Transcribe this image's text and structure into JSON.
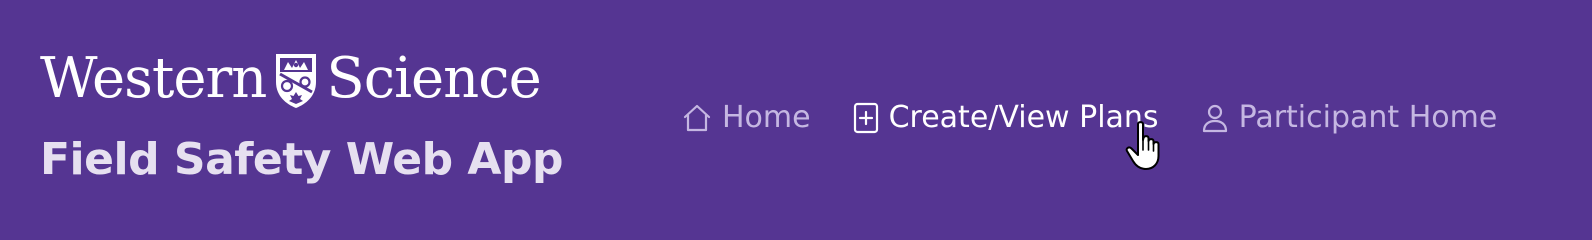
{
  "brand": {
    "word_left": "Western",
    "word_right": "Science",
    "crest_icon": "western-university-crest-icon",
    "app_title": "Field Safety Web App"
  },
  "nav": {
    "items": [
      {
        "label": "Home",
        "icon": "house-icon",
        "active": false
      },
      {
        "label": "Create/View Plans",
        "icon": "add-document-icon",
        "active": true
      },
      {
        "label": "Participant Home",
        "icon": "user-icon",
        "active": false
      }
    ]
  },
  "colors": {
    "header_background": "#553592",
    "nav_text": "#c5b7e2",
    "nav_text_active": "#ffffff",
    "app_title": "#e6e0f0"
  },
  "cursor": "hand-pointer-icon"
}
